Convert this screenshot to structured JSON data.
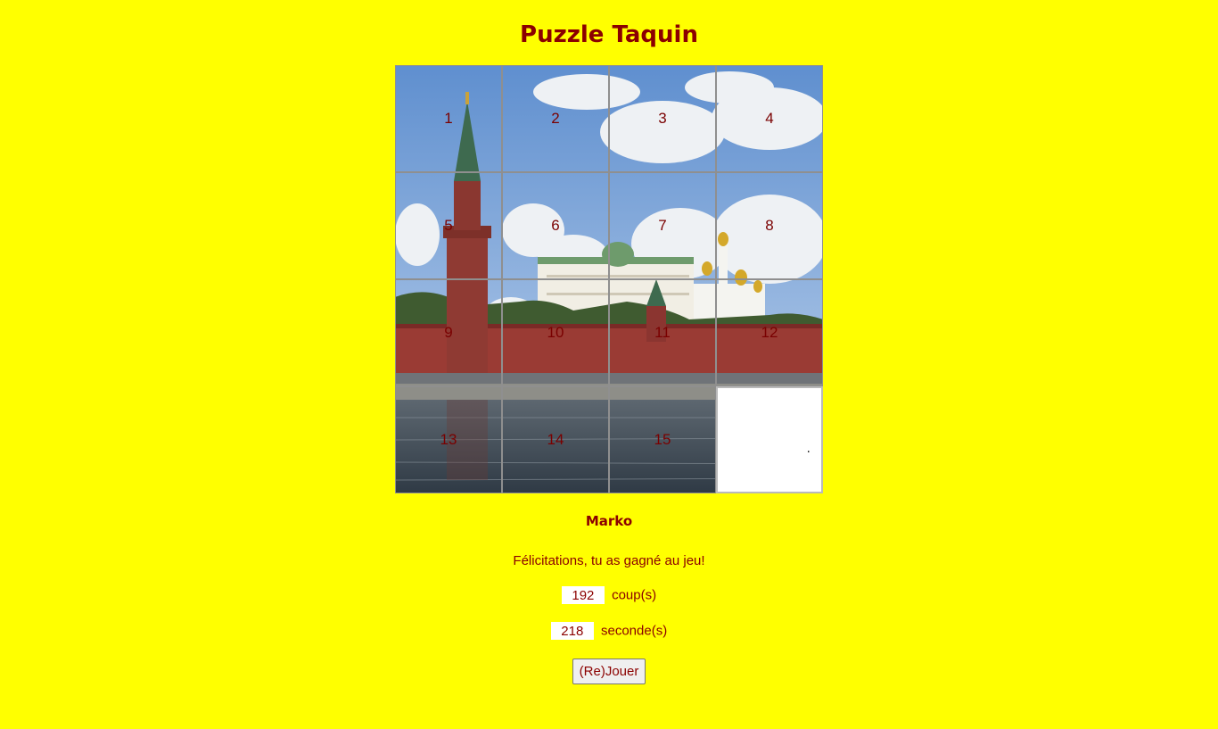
{
  "title": "Puzzle Taquin",
  "board": {
    "tiles": [
      "1",
      "2",
      "3",
      "4",
      "5",
      "6",
      "7",
      "8",
      "9",
      "10",
      "11",
      "12",
      "13",
      "14",
      "15"
    ],
    "empty_marker": "."
  },
  "player_name": "Marko",
  "message": "Félicitations, tu as gagné au jeu!",
  "moves": {
    "value": "192",
    "label": "coup(s)"
  },
  "seconds": {
    "value": "218",
    "label": "seconde(s)"
  },
  "play_button": "(Re)Jouer",
  "colors": {
    "background": "#ffff00",
    "text": "#8b0000"
  }
}
